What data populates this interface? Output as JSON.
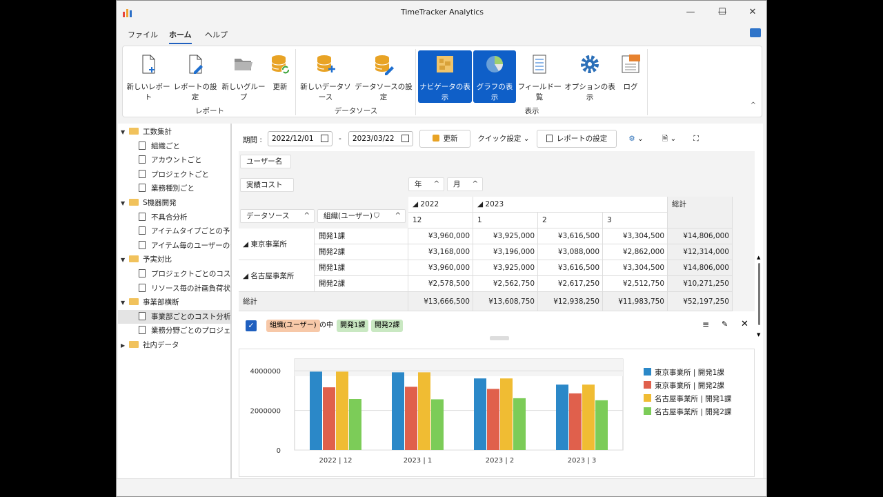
{
  "window": {
    "title": "TimeTracker Analytics",
    "minimize": "—",
    "maximize": "☐",
    "close": "✕"
  },
  "menu": [
    "ファイル",
    "ホーム",
    "ヘルプ"
  ],
  "ribbon": {
    "groups": {
      "report": "レポート",
      "datasource": "データソース",
      "view": "表示"
    },
    "buttons": {
      "new_report": "新しいレポート",
      "report_settings": "レポートの設定",
      "new_group": "新しいグループ",
      "refresh": "更新",
      "new_datasource": "新しいデータソース",
      "datasource_settings": "データソースの設定",
      "show_navigator": "ナビゲータの表示",
      "show_graph": "グラフの表示",
      "field_list": "フィールド一覧",
      "show_options": "オプションの表示",
      "log": "ログ"
    },
    "collapse": "^"
  },
  "tree": [
    {
      "type": "folder",
      "label": "工数集計",
      "level": 0,
      "expanded": true
    },
    {
      "type": "doc",
      "label": "組織ごと",
      "level": 1
    },
    {
      "type": "doc",
      "label": "アカウントごと",
      "level": 1
    },
    {
      "type": "doc",
      "label": "プロジェクトごと",
      "level": 1
    },
    {
      "type": "doc",
      "label": "業務種別ごと",
      "level": 1
    },
    {
      "type": "folder",
      "label": "S機器開発",
      "level": 0,
      "expanded": true
    },
    {
      "type": "doc",
      "label": "不具合分析",
      "level": 1
    },
    {
      "type": "doc",
      "label": "アイテムタイプごとの予実管",
      "level": 1
    },
    {
      "type": "doc",
      "label": "アイテム毎のユーザーの予実",
      "level": 1
    },
    {
      "type": "folder",
      "label": "予実対比",
      "level": 0,
      "expanded": true
    },
    {
      "type": "doc",
      "label": "プロジェクトごとのコスト",
      "level": 1
    },
    {
      "type": "doc",
      "label": "リソース毎の計画負荷状況",
      "level": 1
    },
    {
      "type": "folder",
      "label": "事業部横断",
      "level": 0,
      "expanded": true
    },
    {
      "type": "doc",
      "label": "事業部ごとのコスト分析",
      "level": 1,
      "selected": true
    },
    {
      "type": "doc",
      "label": "業務分野ごとのプロジェクト",
      "level": 1
    },
    {
      "type": "folder",
      "label": "社内データ",
      "level": 0,
      "expanded": false
    }
  ],
  "toolbar": {
    "period_label": "期間 :",
    "date_from": "2022/12/01",
    "date_separator": "-",
    "date_to": "2023/03/22",
    "refresh": "更新",
    "quick_settings": "クイック設定",
    "report_settings": "レポートの設定"
  },
  "pivot": {
    "filter_field": "ユーザー名",
    "data_field": "実績コスト",
    "col_fields": [
      "年",
      "月"
    ],
    "row_fields": [
      "データソース",
      "組織(ユーザー)"
    ],
    "years": [
      "2022",
      "2023"
    ],
    "months": [
      "12",
      "1",
      "2",
      "3"
    ],
    "total_label": "総計",
    "rows": [
      {
        "group": "東京事業所",
        "org": "開発1課",
        "values": [
          "¥3,960,000",
          "¥3,925,000",
          "¥3,616,500",
          "¥3,304,500",
          "¥14,806,000"
        ]
      },
      {
        "group": "",
        "org": "開発2課",
        "values": [
          "¥3,168,000",
          "¥3,196,000",
          "¥3,088,000",
          "¥2,862,000",
          "¥12,314,000"
        ]
      },
      {
        "group": "名古屋事業所",
        "org": "開発1課",
        "values": [
          "¥3,960,000",
          "¥3,925,000",
          "¥3,616,500",
          "¥3,304,500",
          "¥14,806,000"
        ]
      },
      {
        "group": "",
        "org": "開発2課",
        "values": [
          "¥2,578,500",
          "¥2,562,750",
          "¥2,617,250",
          "¥2,512,750",
          "¥10,271,250"
        ]
      }
    ],
    "totals": [
      "¥13,666,500",
      "¥13,608,750",
      "¥12,938,250",
      "¥11,983,750",
      "¥52,197,250"
    ]
  },
  "filter_bar": {
    "field": "組織(ユーザー)",
    "connector": "の中",
    "values": [
      "開発1課",
      "開発2課"
    ]
  },
  "chart_data": {
    "type": "bar",
    "categories": [
      "2022 | 12",
      "2023 | 1",
      "2023 | 2",
      "2023 | 3"
    ],
    "ylim": [
      0,
      4600000
    ],
    "yticks": [
      "0",
      "2000000",
      "4000000"
    ],
    "series": [
      {
        "name": "東京事業所 | 開発1課",
        "color": "#2b88c8",
        "values": [
          3960000,
          3925000,
          3616500,
          3304500
        ]
      },
      {
        "name": "東京事業所 | 開発2課",
        "color": "#e0604c",
        "values": [
          3168000,
          3196000,
          3088000,
          2862000
        ]
      },
      {
        "name": "名古屋事業所 | 開発1課",
        "color": "#f0bc33",
        "values": [
          3960000,
          3925000,
          3616500,
          3304500
        ]
      },
      {
        "name": "名古屋事業所 | 開発2課",
        "color": "#7ccc58",
        "values": [
          2578500,
          2562750,
          2617250,
          2512750
        ]
      }
    ],
    "grid": true,
    "legend": "right"
  }
}
